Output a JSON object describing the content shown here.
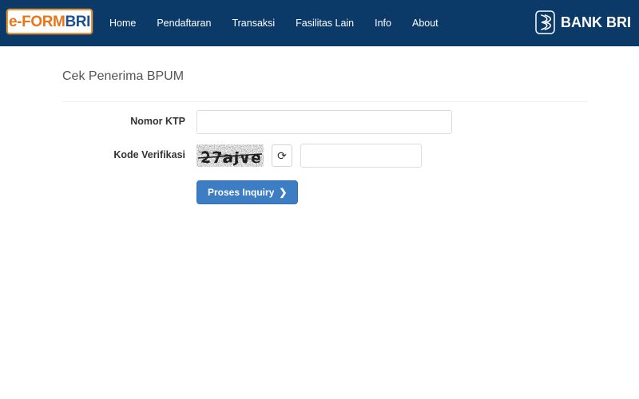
{
  "colors": {
    "header_bg": "#0b3a68",
    "logo_border": "#f0932c",
    "logo_orange": "#e8751a",
    "logo_blue": "#1c4f91",
    "button_blue": "#3c7dc4",
    "page_bg": "#ffffff",
    "rule": "#eeeeee",
    "input_border": "#dcdcdc"
  },
  "header": {
    "logo": {
      "part_e": "e-",
      "part_form": "FORM",
      "part_bri": "BRI",
      "alt": "e-FORM BRI"
    },
    "nav": [
      {
        "label": "Home"
      },
      {
        "label": "Pendaftaran"
      },
      {
        "label": "Transaksi"
      },
      {
        "label": "Fasilitas Lain"
      },
      {
        "label": "Info"
      },
      {
        "label": "About"
      }
    ],
    "bank_logo": {
      "icon": "bank-bri-mark-icon",
      "text": "BANK BRI"
    }
  },
  "main": {
    "page_title": "Cek Penerima BPUM",
    "form": {
      "ktp": {
        "label": "Nomor KTP",
        "value": "",
        "placeholder": ""
      },
      "captcha": {
        "label": "Kode Verifikasi",
        "image_text": "27ajve",
        "refresh_icon": "refresh-icon",
        "refresh_glyph": "⟳",
        "input_value": "",
        "input_placeholder": ""
      },
      "submit": {
        "label": "Proses Inquiry",
        "chevron": "❯"
      }
    }
  }
}
